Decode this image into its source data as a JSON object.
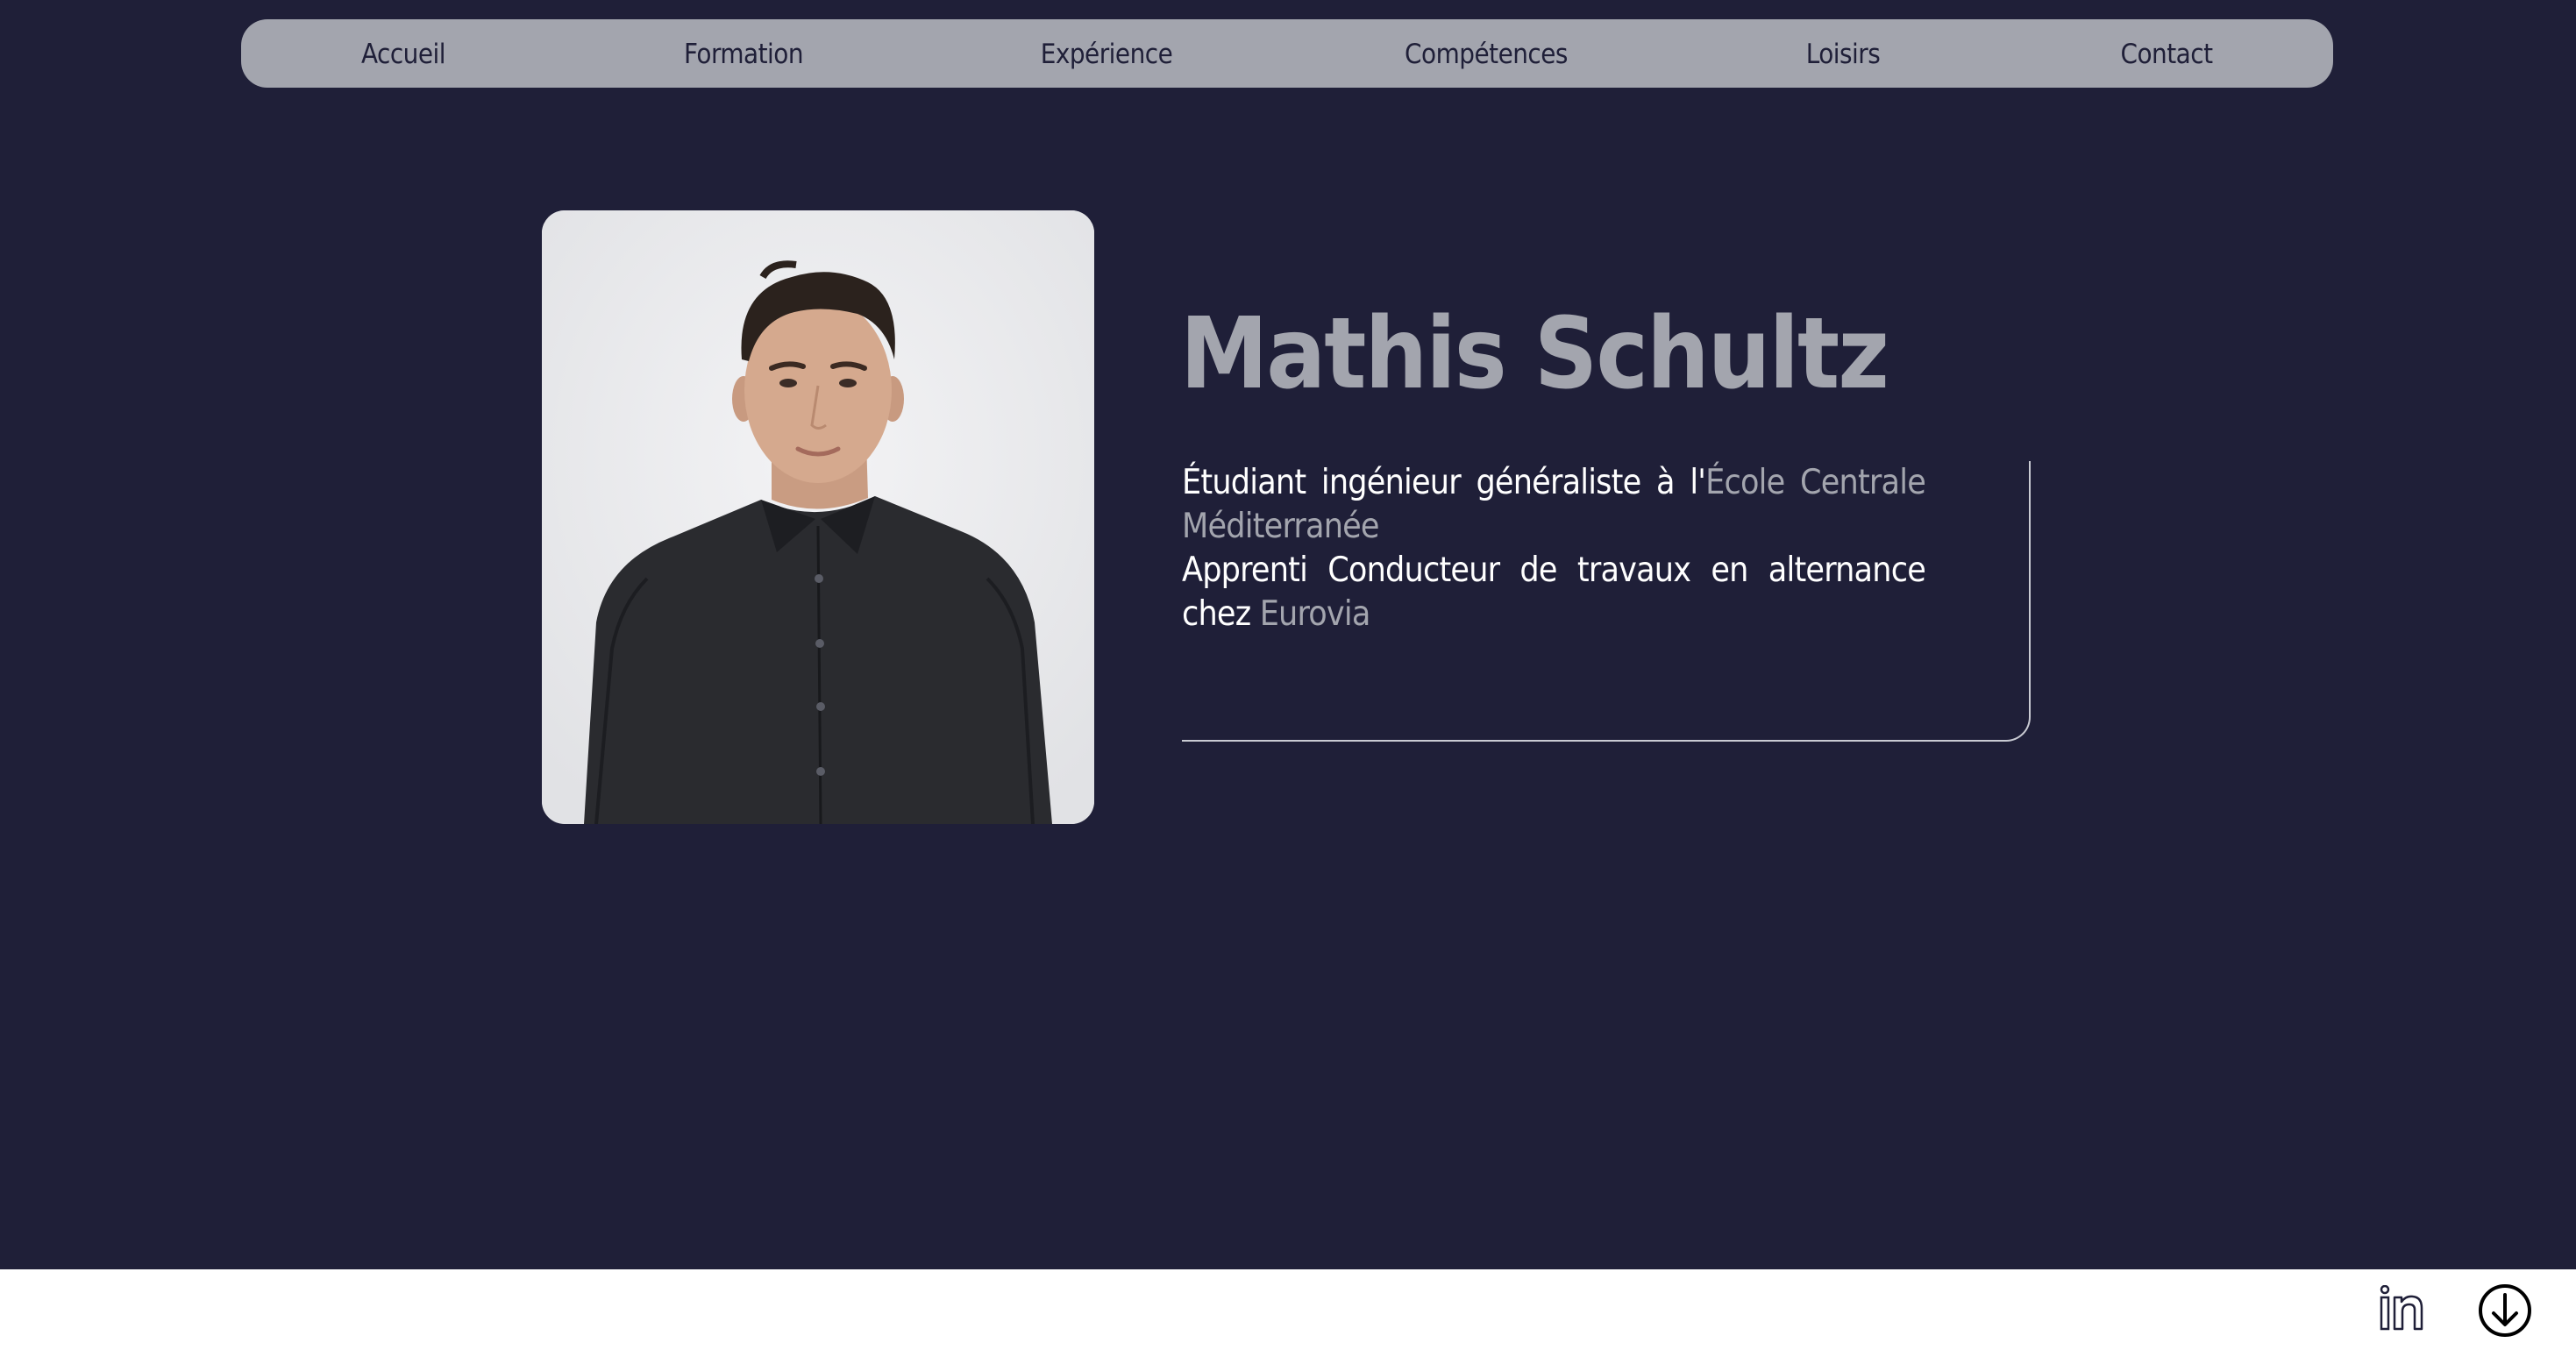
{
  "nav": {
    "items": [
      {
        "label": "Accueil"
      },
      {
        "label": "Formation"
      },
      {
        "label": "Expérience"
      },
      {
        "label": "Compétences"
      },
      {
        "label": "Loisirs"
      },
      {
        "label": "Contact"
      }
    ]
  },
  "profile": {
    "name": "Mathis Schultz",
    "photo_icon": "portrait-photo"
  },
  "bio": {
    "line1_text": "Étudiant ingénieur généraliste à l'",
    "line1_accent": "École Centrale Méditerranée",
    "line2_text": "Apprenti Conducteur de travaux en alternance chez ",
    "line2_accent": "Eurovia"
  },
  "footer": {
    "icons": [
      "linkedin-icon",
      "download-icon"
    ]
  },
  "colors": {
    "background": "#1f1f38",
    "accent_gray": "#a3a5ae",
    "text_white": "#ffffff",
    "footer": "#ffffff"
  }
}
